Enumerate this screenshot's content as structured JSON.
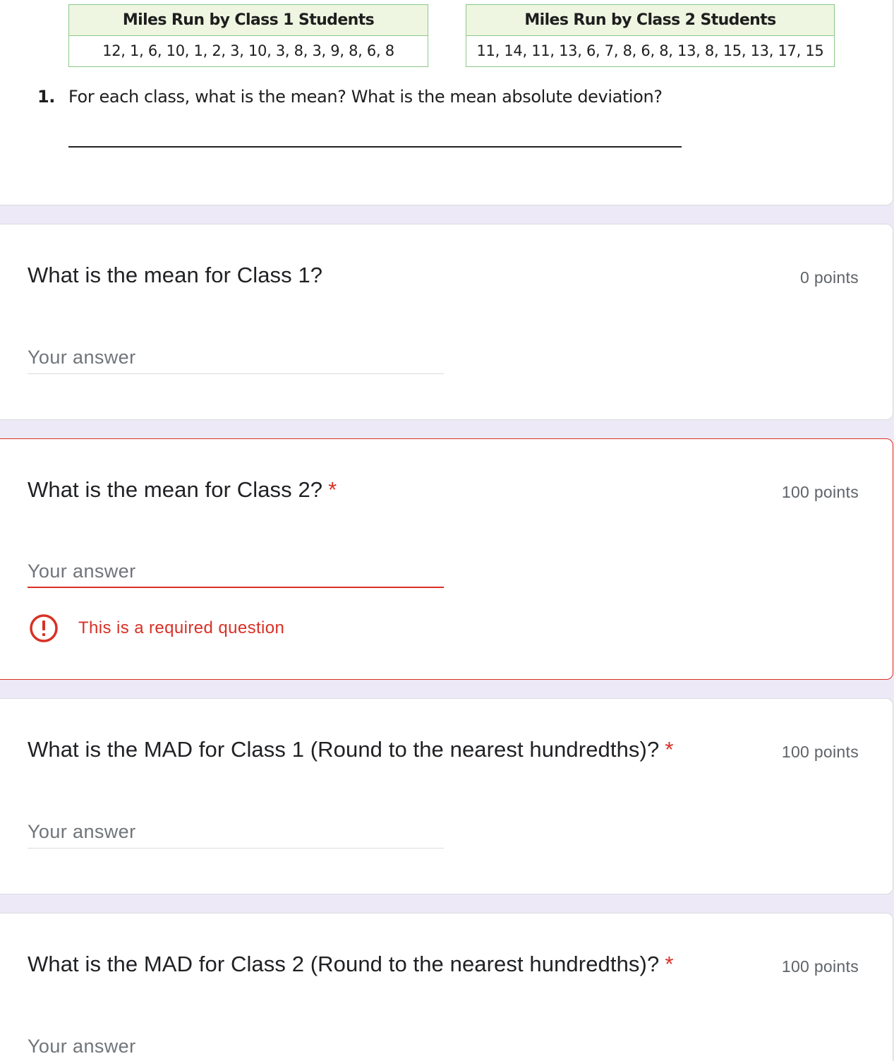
{
  "worksheet": {
    "tables": [
      {
        "header": "Miles Run by Class 1 Students",
        "values": "12, 1, 6, 10, 1, 2, 3, 10, 3, 8, 3, 9, 8, 6, 8"
      },
      {
        "header": "Miles Run by Class 2 Students",
        "values": "11, 14, 11, 13, 6, 7, 8, 6, 8, 13, 8, 15, 13, 17, 15"
      }
    ],
    "exercise_number": "1.",
    "exercise_text": "For each class, what is the mean? What is the mean absolute deviation?"
  },
  "questions": [
    {
      "title": "What is the mean for Class 1?",
      "required": false,
      "required_mark": "",
      "points": "0 points",
      "placeholder": "Your answer",
      "value": ""
    },
    {
      "title": "What is the mean for Class 2?",
      "required": true,
      "required_mark": "*",
      "points": "100 points",
      "placeholder": "Your answer",
      "value": "",
      "error_message": "This is a required question"
    },
    {
      "title": "What is the MAD for Class 1 (Round to the nearest hundredths)?",
      "required": true,
      "required_mark": "*",
      "points": "100 points",
      "placeholder": "Your answer",
      "value": ""
    },
    {
      "title": "What is the MAD for Class 2 (Round to the nearest hundredths)?",
      "required": true,
      "required_mark": "*",
      "points": "100 points",
      "placeholder": "Your answer",
      "value": ""
    }
  ],
  "colors": {
    "background": "#ede9f6",
    "card": "#ffffff",
    "error": "#d93025",
    "table_border": "#8cc98a",
    "table_header_bg": "#eef5e1",
    "muted_text": "#5f6368"
  },
  "icons": {
    "error": "error-circle-icon"
  }
}
